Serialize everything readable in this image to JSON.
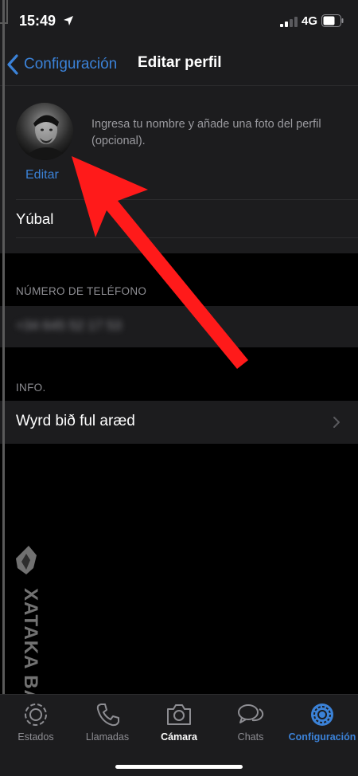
{
  "status_bar": {
    "time": "15:49",
    "network": "4G",
    "icons": [
      "location-arrow-icon",
      "cellular-signal-icon",
      "battery-icon"
    ]
  },
  "nav": {
    "back_label": "Configuración",
    "title": "Editar perfil",
    "back_icon": "chevron-left-icon"
  },
  "profile": {
    "edit_label": "Editar",
    "hint": "Ingresa tu nombre y añade una foto del perfil (opcional).",
    "name": "Yúbal"
  },
  "phone": {
    "header": "NÚMERO DE TELÉFONO",
    "value": "+34 645 52 17 53"
  },
  "info": {
    "header": "INFO.",
    "value": "Wyrd bið ful aræd"
  },
  "watermark": {
    "text": "XATAKA BASICS"
  },
  "tabs": [
    {
      "label": "Estados",
      "icon": "status-icon"
    },
    {
      "label": "Llamadas",
      "icon": "phone-icon"
    },
    {
      "label": "Cámara",
      "icon": "camera-icon"
    },
    {
      "label": "Chats",
      "icon": "chat-bubbles-icon"
    },
    {
      "label": "Configuración",
      "icon": "settings-gear-icon",
      "active": true
    }
  ],
  "colors": {
    "accent": "#3b82d8",
    "background": "#000000",
    "surface": "#1c1c1e",
    "secondary_text": "#8e8e93",
    "arrow": "#ff1a1a"
  }
}
